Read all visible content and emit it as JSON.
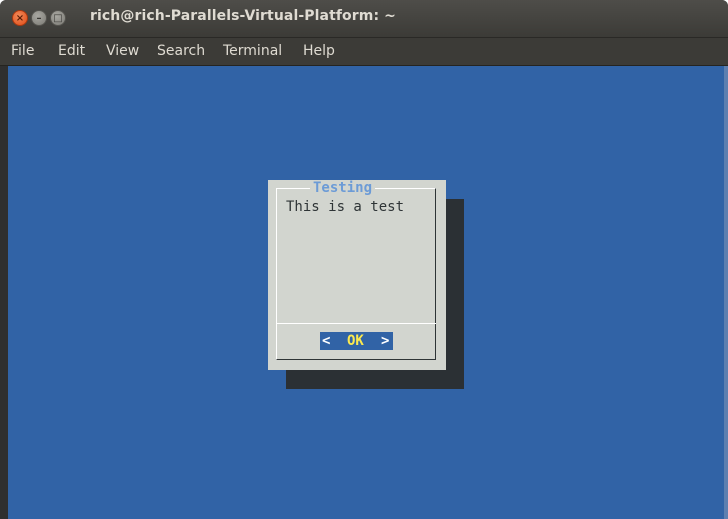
{
  "window": {
    "title": "rich@rich-Parallels-Virtual-Platform: ~",
    "buttons": {
      "close_glyph": "×",
      "minimize_glyph": "–",
      "maximize_glyph": "□"
    }
  },
  "menubar": {
    "items": [
      "File",
      "Edit",
      "View",
      "Search",
      "Terminal",
      "Help"
    ]
  },
  "dialog": {
    "title": "Testing",
    "message": "This is a test",
    "ok_button": {
      "left_bracket": "<",
      "label": "OK",
      "right_bracket": ">"
    }
  },
  "colors": {
    "terminal_background": "#3163a6",
    "dialog_background": "#d2d5cf",
    "dialog_shadow": "#2b3034",
    "title_color": "#6c9bd6",
    "ok_label_color": "#fce94f"
  }
}
